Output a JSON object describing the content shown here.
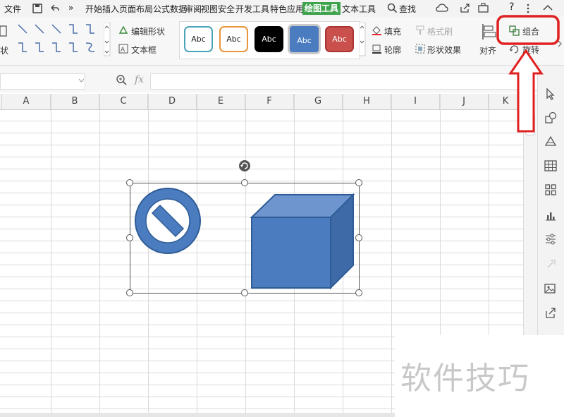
{
  "menu": {
    "file": "文件",
    "more": "»",
    "tabs": [
      "开始",
      "插入",
      "页面布局",
      "公式",
      "数据",
      "审阅",
      "视图",
      "安全",
      "开发工具",
      "特色应用",
      "绘图工具",
      "文本工具"
    ],
    "active_tab": "绘图工具",
    "search": "查找",
    "help": "?"
  },
  "ribbon": {
    "shape_label_partial": "状",
    "edit_shape": "编辑形状",
    "text_box": "文本框",
    "styles": [
      "Abc",
      "Abc",
      "Abc",
      "Abc",
      "Abc"
    ],
    "fill": "填充",
    "format_painter": "格式刷",
    "outline": "轮廓",
    "shape_effects": "形状效果",
    "align": "对齐",
    "group": "组合",
    "rotate": "旋转"
  },
  "formula_bar": {
    "fx": "fx"
  },
  "columns": [
    "A",
    "B",
    "C",
    "D",
    "E",
    "F",
    "G",
    "H",
    "I",
    "J",
    "K"
  ],
  "watermark": "软件技巧",
  "colors": {
    "active_tab": "#3fa34d",
    "shape_fill": "#4a7cbf",
    "shape_stroke": "#2f5c96",
    "annotation": "#e02020"
  }
}
